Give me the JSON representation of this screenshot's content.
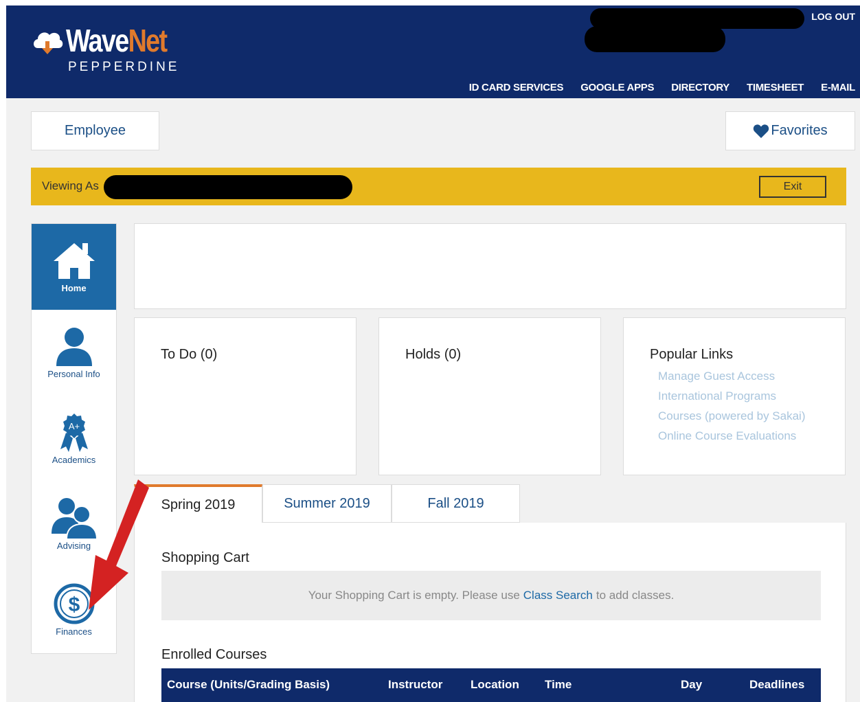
{
  "header": {
    "logo_wave": "Wave",
    "logo_net": "Net",
    "logo_sub": "PEPPERDINE",
    "logout": "LOG OUT",
    "nav": [
      "ID CARD SERVICES",
      "GOOGLE APPS",
      "DIRECTORY",
      "TIMESHEET",
      "E-MAIL"
    ]
  },
  "role_tab": "Employee",
  "favorites": "Favorites",
  "viewing_bar": {
    "label": "Viewing As",
    "exit": "Exit"
  },
  "sidebar": {
    "items": [
      {
        "label": "Home",
        "icon": "home-icon"
      },
      {
        "label": "Personal Info",
        "icon": "person-icon"
      },
      {
        "label": "Academics",
        "icon": "award-ribbon-icon"
      },
      {
        "label": "Advising",
        "icon": "people-icon"
      },
      {
        "label": "Finances",
        "icon": "dollar-icon"
      }
    ]
  },
  "cards": {
    "todo": "To Do (0)",
    "holds": "Holds (0)",
    "popular": {
      "title": "Popular Links",
      "links": [
        "Manage Guest Access",
        "International Programs",
        "Courses (powered by Sakai)",
        "Online Course Evaluations"
      ]
    }
  },
  "term_tabs": [
    "Spring 2019",
    "Summer 2019",
    "Fall 2019"
  ],
  "shopping_cart": {
    "title": "Shopping Cart",
    "msg_before": "Your Shopping Cart is empty. Please use",
    "link": "Class Search",
    "msg_after": "to add classes."
  },
  "enrolled": {
    "title": "Enrolled Courses",
    "columns": [
      "Course (Units/Grading Basis)",
      "Instructor",
      "Location",
      "Time",
      "Day",
      "Deadlines"
    ]
  },
  "colors": {
    "header_bg": "#0f2a6a",
    "accent_orange": "#e07a2c",
    "banner_yellow": "#e8b71c",
    "link_blue": "#1b4f86",
    "active_nav": "#1d69a6",
    "annotation_red": "#d42222"
  }
}
